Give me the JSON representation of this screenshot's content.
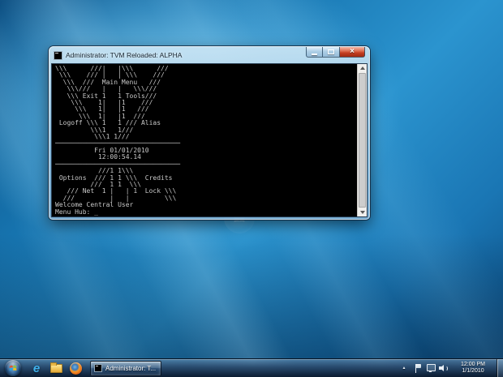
{
  "window": {
    "title": "Administrator: TVM Reloaded: ALPHA",
    "console": {
      "screen_text": "\\\\\\      ///|   |\\\\\\      ///\n \\\\\\    /// |   | \\\\\\    ///\n  \\\\\\  ///  Main Menu   ///\n   \\\\\\///   |   |   \\\\\\///\n   \\\\\\ Exit 1   1 Tools///\n    \\\\\\    1|   |1    ///\n     \\\\\\   1|   |1   ///\n      \\\\\\  1|   |1  ///\n Logoff \\\\\\ 1   1 /// Alias\n         \\\\\\1   1///\n          \\\\\\1 1///\n────────────────────────────────\n          Fri 01/01/2010\n           12:00:54.14\n────────────────────────────────\n           ///1 1\\\\\\\n Options  /// 1 1 \\\\\\  Credits\n         ///  1 1  \\\\\\\n   /// Net  1 |   | 1  Lock \\\\\\\n  ///         |   |         \\\\\\\nWelcome Central User\n",
      "prompt": "Menu Hub: ",
      "cursor": "_",
      "menu_title": "Main Menu",
      "menu_items": [
        "Exit",
        "Tools",
        "Logoff",
        "Alias",
        "Options",
        "Credits",
        "Net",
        "Lock"
      ],
      "date_line": "Fri 01/01/2010",
      "time_line": "12:00:54.14",
      "welcome_line": "Welcome Central User"
    }
  },
  "taskbar": {
    "task_button_label": "Administrator: T...",
    "clock": {
      "time": "12:00 PM",
      "date": "1/1/2010"
    }
  },
  "icons": {
    "close_glyph": "×",
    "ie_glyph": "e",
    "show_hidden_arrow": "▲"
  },
  "colors": {
    "close_red": "#c43e22",
    "console_text": "#c8c8c8",
    "wallpaper_blue": "#2b94cf",
    "taskbar_dark": "#0a182c"
  }
}
